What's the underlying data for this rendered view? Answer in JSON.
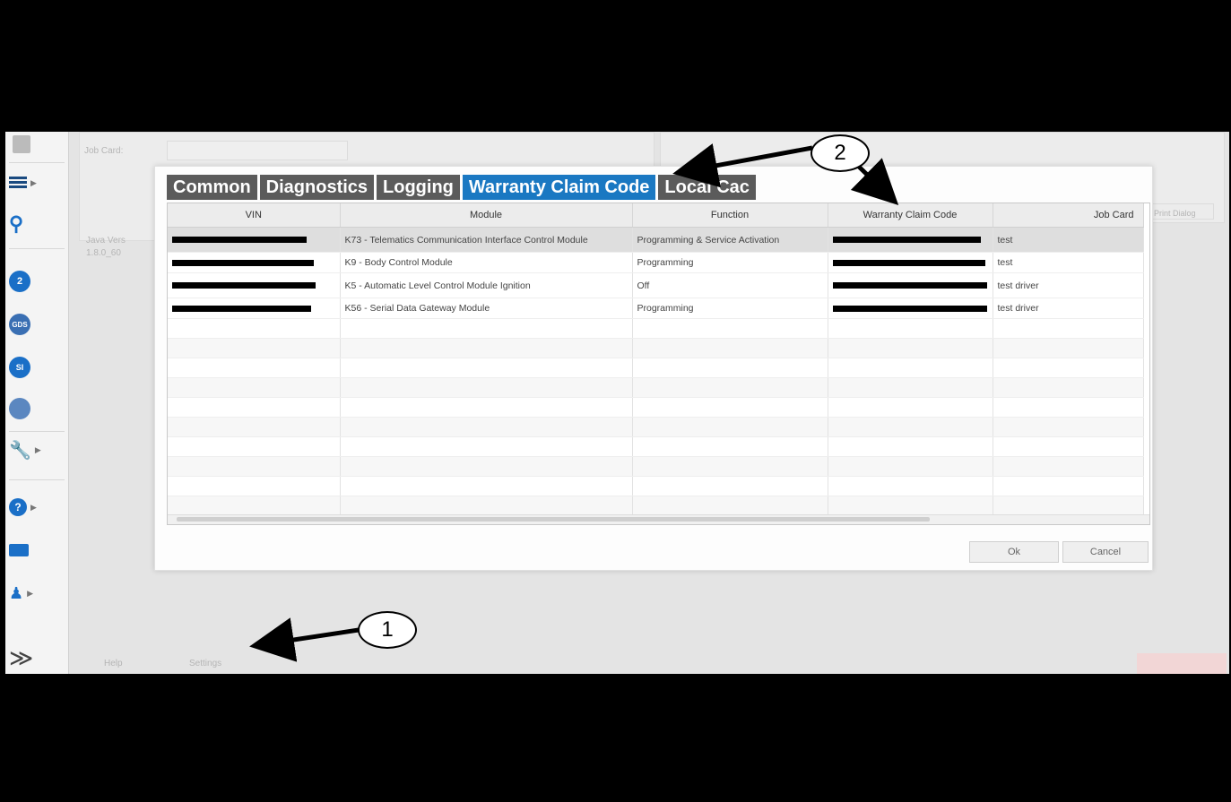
{
  "background": {
    "field_job_card": "Job Card:",
    "field_java": "Java Vers",
    "field_java_value": "1.8.0_60",
    "bottom_tab_1": "Help",
    "bottom_tab_2": "Settings",
    "right_button": "Print Dialog"
  },
  "sidebar": {
    "items": [
      {
        "icon": "list-icon",
        "label": "list"
      },
      {
        "icon": "search-icon",
        "label": "search"
      },
      {
        "icon": "gds2-icon",
        "label": "2"
      },
      {
        "icon": "gds-icon",
        "label": "GDS"
      },
      {
        "icon": "si-icon",
        "label": "SI"
      },
      {
        "icon": "vehicle-icon",
        "label": ""
      },
      {
        "icon": "wrench-icon",
        "label": ""
      },
      {
        "icon": "help-icon",
        "label": "?"
      },
      {
        "icon": "mail-icon",
        "label": ""
      },
      {
        "icon": "user-icon",
        "label": ""
      },
      {
        "icon": "expand-icon",
        "label": "≫"
      }
    ]
  },
  "dialog": {
    "tabs": [
      "Common",
      "Diagnostics",
      "Logging",
      "Warranty Claim Code",
      "Local Cac"
    ],
    "active_tab": "Warranty Claim Code",
    "columns": [
      "VIN",
      "Module",
      "Function",
      "Warranty Claim Code",
      "Job Card"
    ],
    "rows": [
      {
        "module": "K73 - Telematics Communication Interface Control Module",
        "function": "Programming & Service Activation",
        "job_card": "test"
      },
      {
        "module": "K9 - Body Control Module",
        "function": "Programming",
        "job_card": "test"
      },
      {
        "module": "K5 - Automatic Level Control Module Ignition",
        "function": "Off",
        "job_card": "test driver"
      },
      {
        "module": "K56 - Serial Data Gateway Module",
        "function": "Programming",
        "job_card": "test driver"
      }
    ],
    "ok_label": "Ok",
    "cancel_label": "Cancel"
  },
  "annotations": {
    "callout_1": "1",
    "callout_2": "2"
  },
  "colors": {
    "active_tab": "#1a78c2",
    "inactive_tab": "#5b5b5b",
    "accent": "#1a6fc7"
  }
}
